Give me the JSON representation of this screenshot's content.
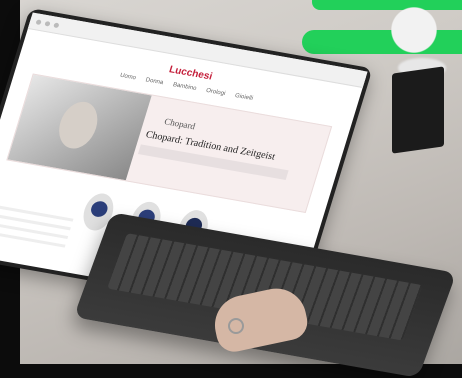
{
  "site": {
    "logo": "Lucchesi",
    "nav_items": [
      "Uomo",
      "Donna",
      "Bambino",
      "Orologi",
      "Gioielli"
    ],
    "hero": {
      "brand": "Chopard",
      "headline": "Chopard: Tradition and Zeitgeist"
    }
  }
}
